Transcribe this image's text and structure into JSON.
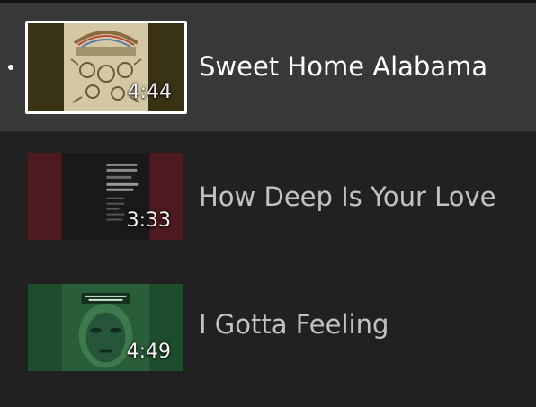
{
  "playlist": {
    "items": [
      {
        "title": "Sweet Home Alabama",
        "duration": "4:44",
        "active": true,
        "thumbnail_icon": "album-art-sweet-home-alabama",
        "colors": {
          "side": "#3a2e12",
          "cover": "#cfc3a0"
        }
      },
      {
        "title": "How Deep Is Your Love",
        "duration": "3:33",
        "active": false,
        "thumbnail_icon": "album-art-how-deep-is-your-love",
        "colors": {
          "side": "#4a171c",
          "cover": "#1c1c1f"
        }
      },
      {
        "title": "I Gotta Feeling",
        "duration": "4:49",
        "active": false,
        "thumbnail_icon": "album-art-i-gotta-feeling",
        "colors": {
          "side": "#1b4a2a",
          "cover": "#2c6b3f"
        }
      }
    ]
  },
  "colors": {
    "background": "#212121",
    "active_row": "#383838",
    "active_title": "#ffffff",
    "inactive_title": "#c2c2c2"
  }
}
